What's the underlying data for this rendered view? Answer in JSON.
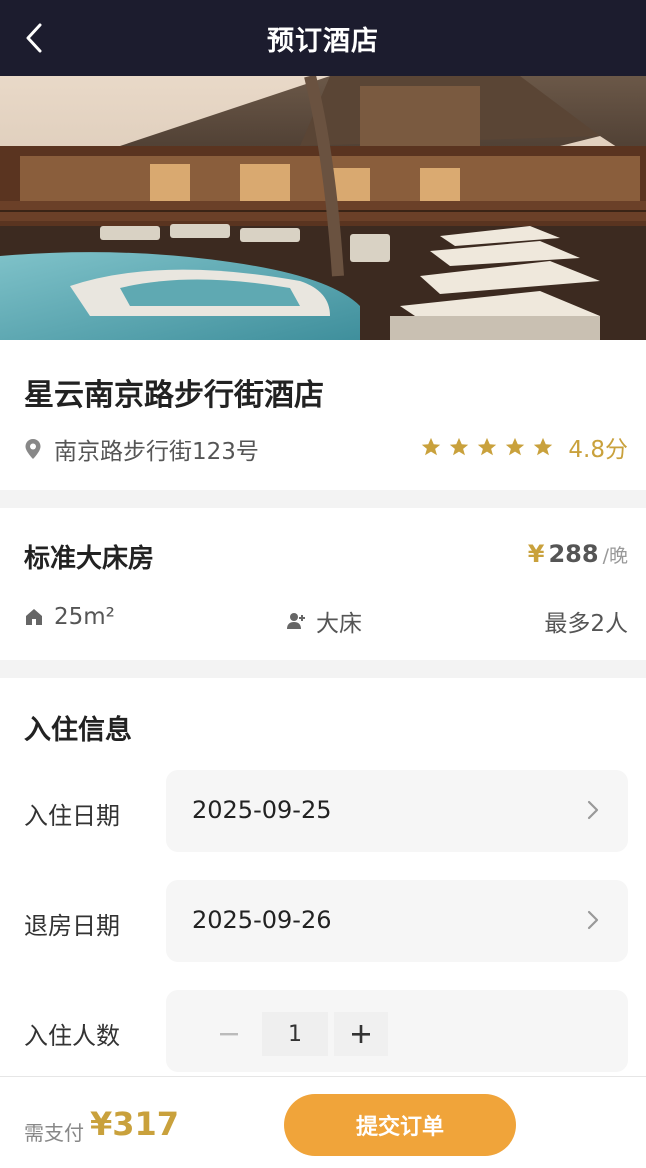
{
  "header": {
    "title": "预订酒店",
    "back_icon": "chevron-left-icon"
  },
  "hotel": {
    "name": "星云南京路步行街酒店",
    "address": "南京路步行街123号",
    "stars": 5,
    "rating": "4.8分",
    "accent_color": "#c9a13c"
  },
  "room": {
    "name": "标准大床房",
    "currency": "¥",
    "price": "288",
    "unit": "/晚",
    "area": "25m²",
    "bed": "大床",
    "max_guests": "最多2人"
  },
  "checkin": {
    "title": "入住信息",
    "checkin_label": "入住日期",
    "checkin_date": "2025-09-25",
    "checkout_label": "退房日期",
    "checkout_date": "2025-09-26",
    "guests_label": "入住人数",
    "guests": "1"
  },
  "footer": {
    "pay_label": "需支付",
    "pay_amount": "¥317",
    "submit_label": "提交订单",
    "button_color": "#f0a43a"
  },
  "colors": {
    "header_bg": "#1c1c2e",
    "accent": "#c9a13c",
    "button": "#f0a43a"
  }
}
